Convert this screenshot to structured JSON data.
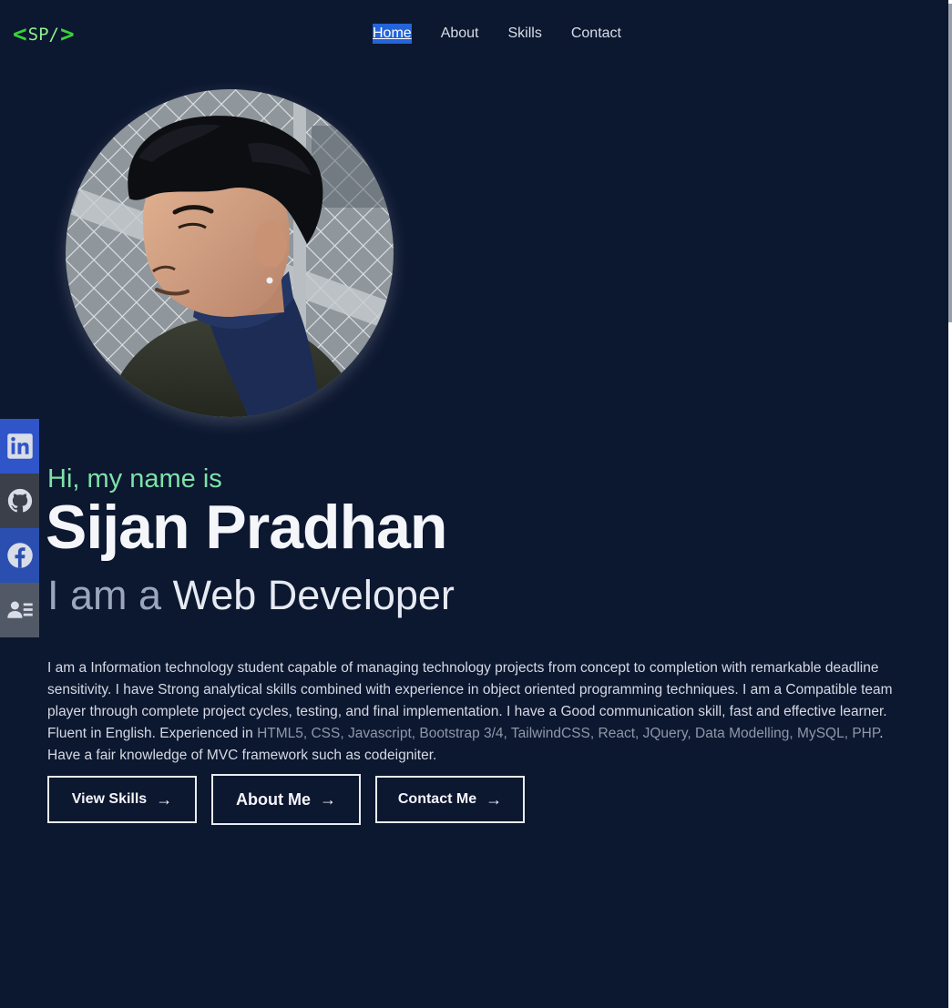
{
  "logo": {
    "left": "<",
    "text": "SP/",
    "right": ">"
  },
  "nav": {
    "items": [
      {
        "label": "Home",
        "active": true
      },
      {
        "label": "About"
      },
      {
        "label": "Skills"
      },
      {
        "label": "Contact"
      }
    ]
  },
  "social": {
    "icons": [
      "linkedin-icon",
      "github-icon",
      "facebook-icon",
      "contact-card-icon"
    ]
  },
  "hero": {
    "greeting": "Hi, my name is",
    "name": "Sijan Pradhan",
    "role_prefix": "I am a",
    "role": "Web Developer",
    "bio_part1": "I am a Information technology student capable of managing technology projects from concept to completion with remarkable deadline sensitivity. I have Strong analytical skills combined with experience in object oriented programming techniques. I am a Compatible team player through complete project cycles, testing, and final implementation. I have a Good communication skill, fast and effective learner. Fluent in English. Experienced in ",
    "bio_tech": "HTML5, CSS, Javascript, Bootstrap 3/4, TailwindCSS, React, JQuery, Data Modelling, MySQL, PHP",
    "bio_part2": ". Have a fair knowledge of MVC framework such as codeigniter."
  },
  "buttons": {
    "view_skills": "View Skills",
    "about_me": "About Me",
    "contact_me": "Contact Me",
    "arrow": "→"
  },
  "colors": {
    "background": "#0c1730",
    "accent_green": "#7ee2a8",
    "nav_active": "#2364d8"
  }
}
